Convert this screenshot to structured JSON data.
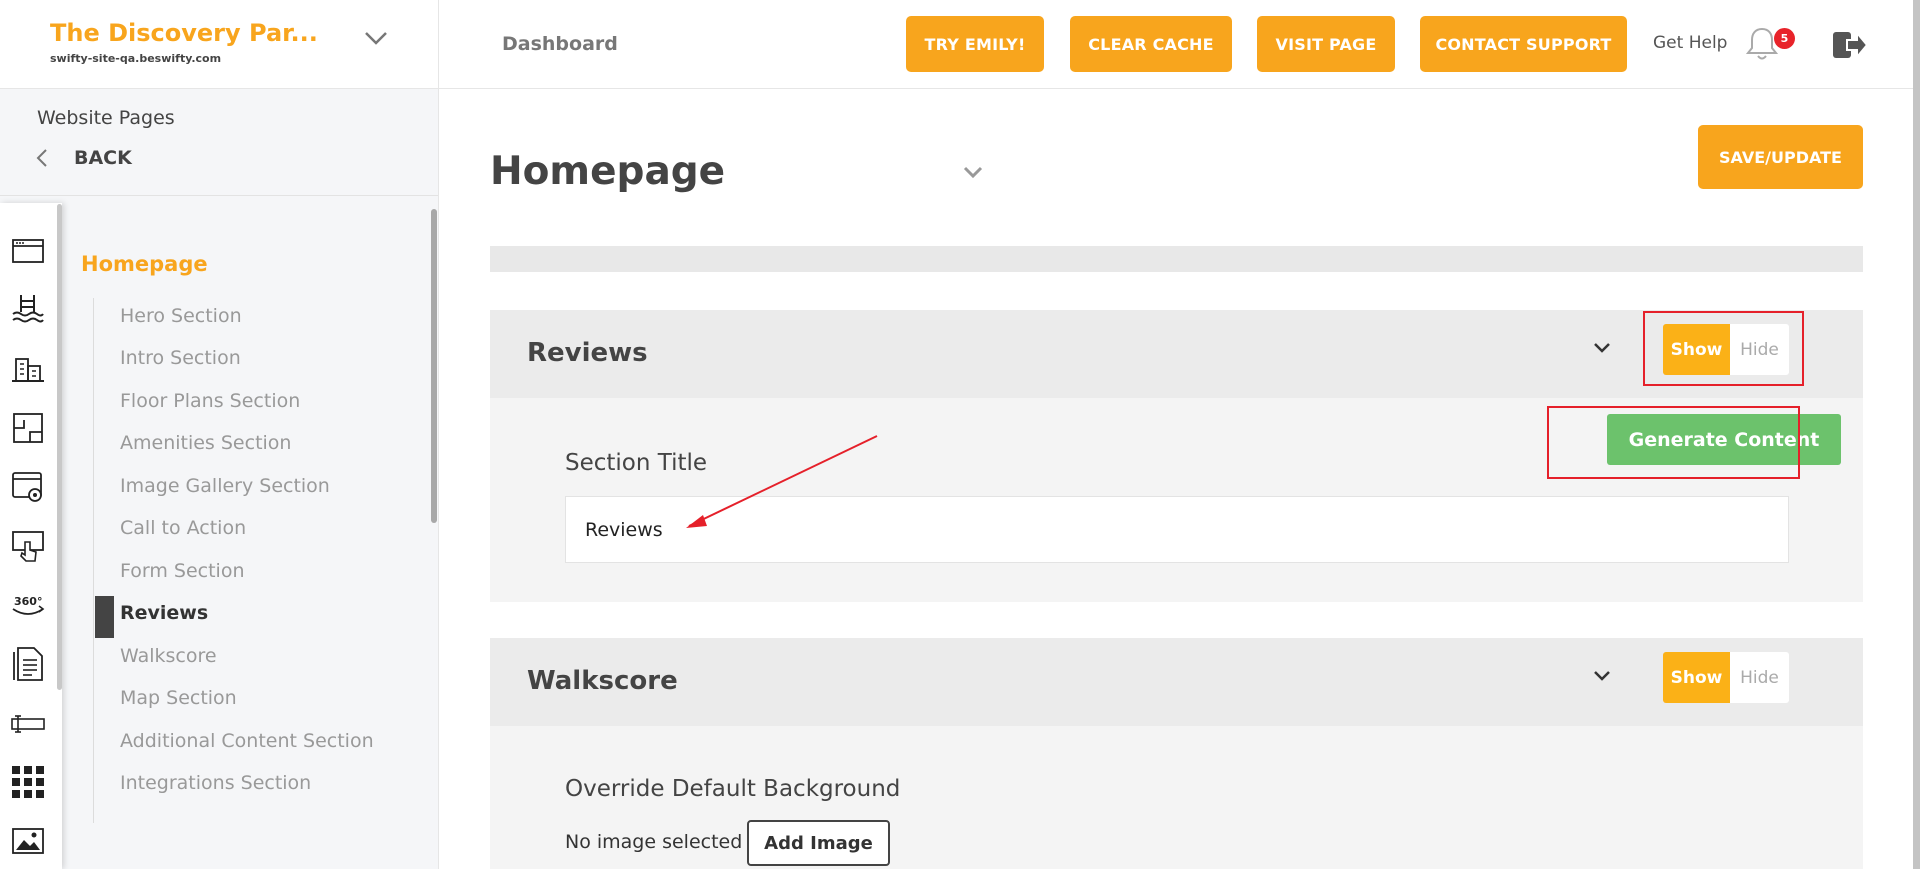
{
  "brand": {
    "title": "The Discovery Par...",
    "subtitle": "swifty-site-qa.beswifty.com"
  },
  "topbar": {
    "dashboard": "Dashboard",
    "buttons": [
      "TRY EMILY!",
      "CLEAR CACHE",
      "VISIT PAGE",
      "CONTACT SUPPORT"
    ],
    "get_help": "Get Help",
    "notifications_count": "5"
  },
  "sidebar": {
    "title": "Website Pages",
    "back": "BACK",
    "page_heading": "Homepage",
    "items": [
      "Hero Section",
      "Intro Section",
      "Floor Plans Section",
      "Amenities Section",
      "Image Gallery Section",
      "Call to Action",
      "Form Section",
      "Reviews",
      "Walkscore",
      "Map Section",
      "Additional Content Section",
      "Integrations Section"
    ],
    "active_item": "Reviews",
    "rail_icons": [
      "browser-window-icon",
      "pool-icon",
      "buildings-icon",
      "floor-plan-icon",
      "web-settings-icon",
      "touch-screen-icon",
      "360-view-icon",
      "document-icon",
      "input-field-icon",
      "grid-icon",
      "image-icon"
    ]
  },
  "main": {
    "page_title": "Homepage",
    "save_button": "SAVE/UPDATE",
    "sections": [
      {
        "name": "Reviews",
        "toggle_show": "Show",
        "toggle_hide": "Hide",
        "generate_button": "Generate Content",
        "field_label": "Section Title",
        "field_value": "Reviews"
      },
      {
        "name": "Walkscore",
        "toggle_show": "Show",
        "toggle_hide": "Hide",
        "field_label": "Override Default Background",
        "no_image": "No image selected",
        "add_image": "Add Image"
      }
    ]
  },
  "colors": {
    "accent": "#f8a51d",
    "toggle_on": "#fbb117",
    "generate": "#6cc26c",
    "annotation_red": "#e5202a"
  }
}
